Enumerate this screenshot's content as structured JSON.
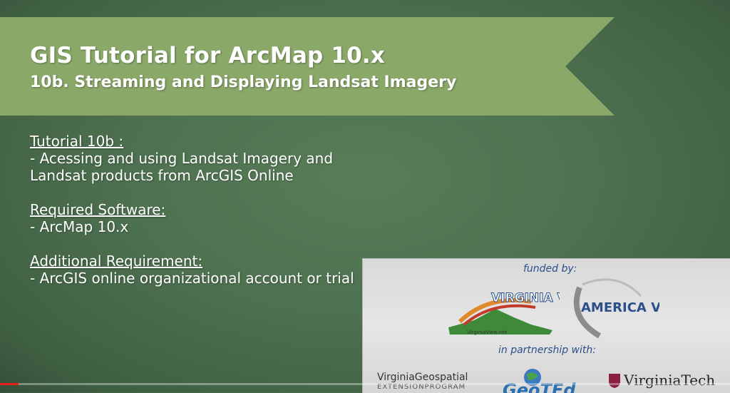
{
  "banner": {
    "title": "GIS Tutorial for ArcMap 10.x",
    "subtitle": "10b. Streaming and Displaying Landsat Imagery"
  },
  "content": {
    "sections": [
      {
        "heading": "Tutorial 10b :",
        "lines": [
          "- Acessing and using Landsat Imagery and",
          "Landsat products from ArcGIS Online"
        ]
      },
      {
        "heading": "Required Software:",
        "lines": [
          "- ArcMap 10.x"
        ]
      },
      {
        "heading": "Additional Requirement:",
        "lines": [
          "- ArcGIS online organizational account or trial"
        ]
      }
    ]
  },
  "logos": {
    "funded_by": "funded by:",
    "in_partnership": "in partnership with:",
    "virginia_view": "VIRGINIA VIEW",
    "virginia_view_url": "VirginiaView.net",
    "america_view": "AMERICA VIEW",
    "vgep_main": "VirginiaGeospatial",
    "vgep_sub": "EXTENSIONPROGRAM",
    "geoted": "GeoTEd",
    "virginia_tech": "VirginiaTech"
  },
  "video": {
    "progress_fraction": 0.025
  },
  "colors": {
    "background": "#4e7150",
    "banner": "#8aa868",
    "progress": "#e62117"
  }
}
